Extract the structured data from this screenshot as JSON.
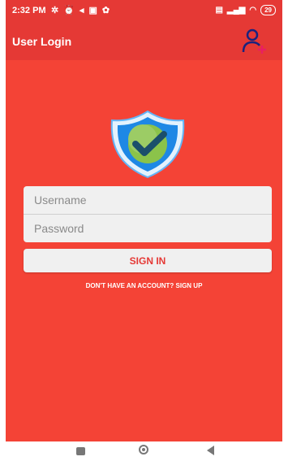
{
  "status_bar": {
    "time": "2:32 PM",
    "battery": "29"
  },
  "app_bar": {
    "title": "User Login",
    "add_user_icon": "person-add-icon"
  },
  "login_form": {
    "username_placeholder": "Username",
    "password_placeholder": "Password",
    "sign_in_label": "SIGN IN",
    "signup_prompt": "DON'T HAVE AN ACCOUNT?  SIGN UP"
  },
  "nav_bar": {
    "recents_icon": "square-icon",
    "home_icon": "circle-icon",
    "back_icon": "triangle-back-icon"
  },
  "colors": {
    "background": "#f44336",
    "app_bar": "#e53935",
    "accent_text": "#e53935",
    "field_background": "#f0f0f0"
  }
}
